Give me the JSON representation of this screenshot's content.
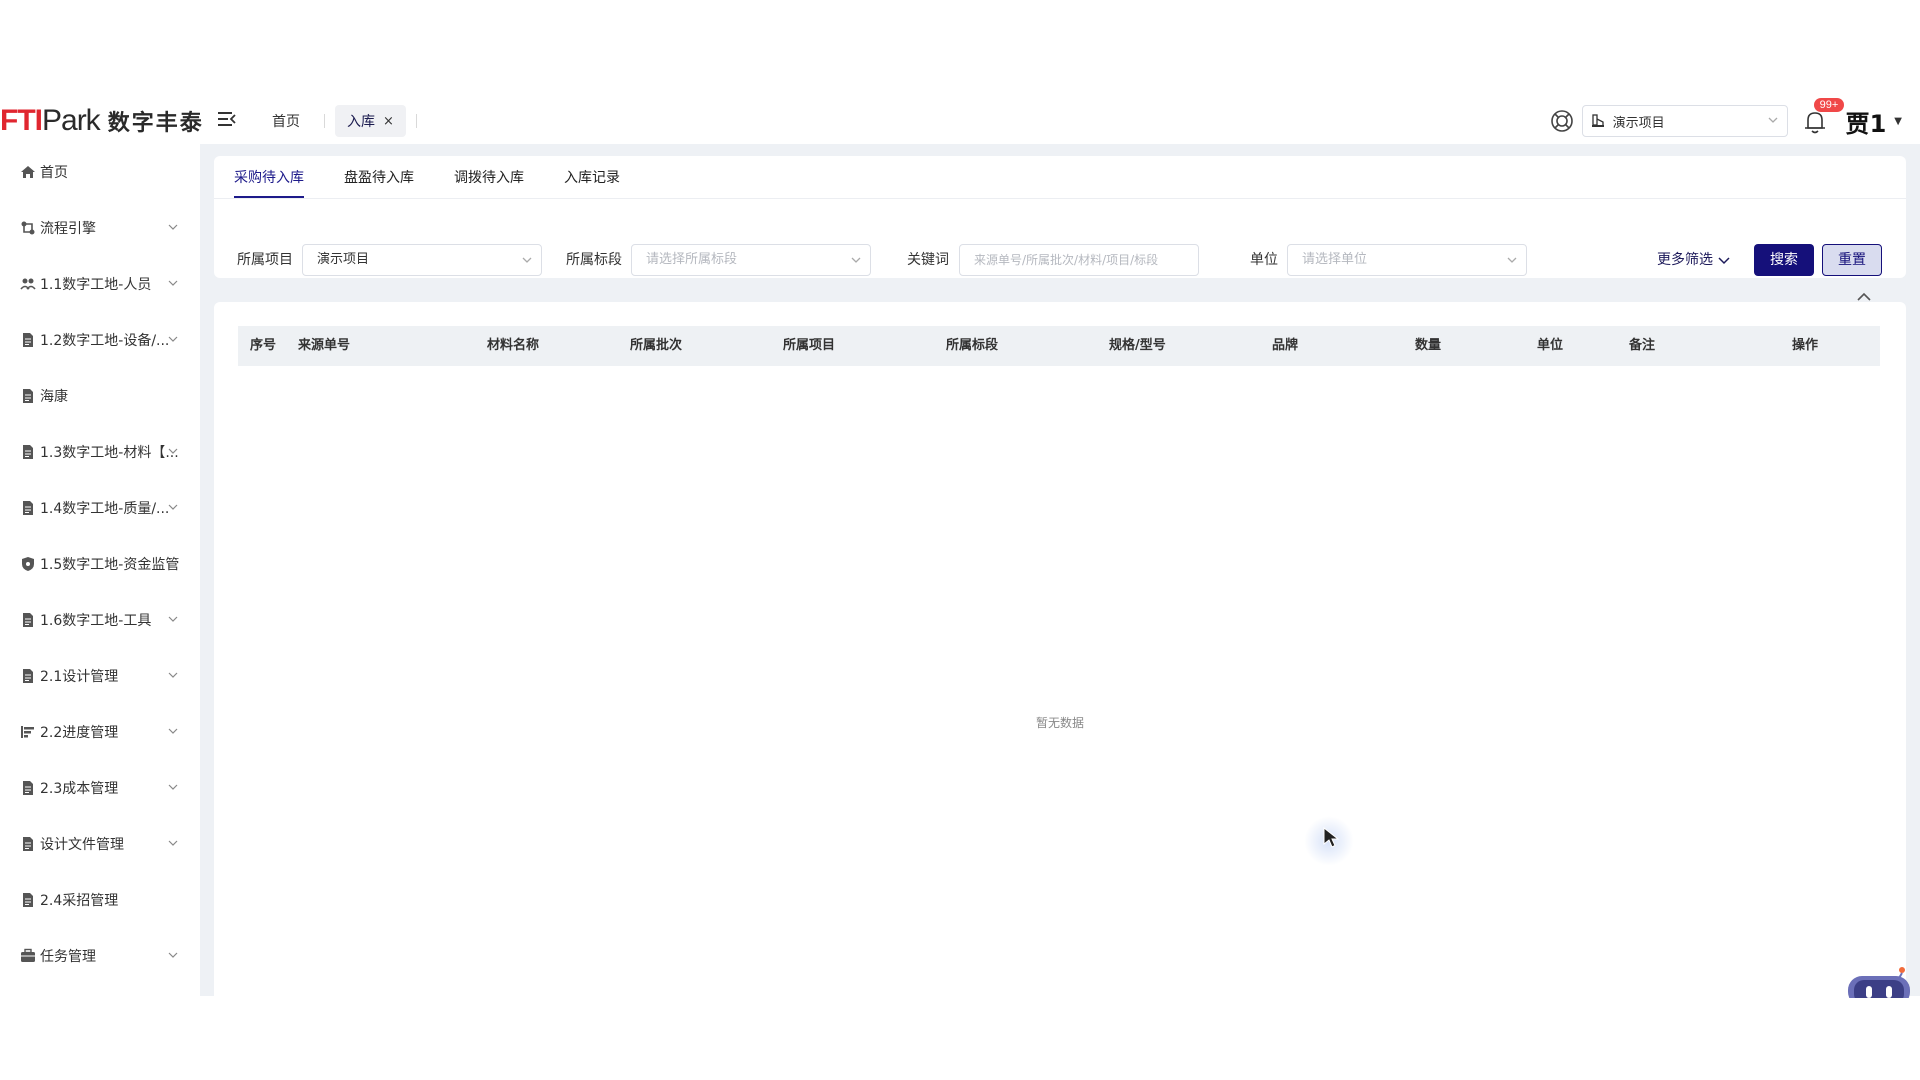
{
  "header": {
    "logo": {
      "part1": "FTI",
      "part2": "Park",
      "cn": "数字丰泰"
    },
    "tabs": {
      "home": "首页",
      "active": "入库",
      "close": "×"
    },
    "project_select": "演示项目",
    "notifications_badge": "99+",
    "user": "贾1"
  },
  "sidebar": {
    "items": [
      {
        "label": "首页",
        "icon": "home-icon",
        "expandable": false
      },
      {
        "label": "流程引擎",
        "icon": "flow-icon",
        "expandable": true
      },
      {
        "label": "1.1数字工地-人员",
        "icon": "people-icon",
        "expandable": true
      },
      {
        "label": "1.2数字工地-设备/...",
        "icon": "document-icon",
        "expandable": true
      },
      {
        "label": "海康",
        "icon": "document-icon",
        "expandable": false
      },
      {
        "label": "1.3数字工地-材料【...",
        "icon": "document-icon",
        "expandable": true
      },
      {
        "label": "1.4数字工地-质量/...",
        "icon": "document-icon",
        "expandable": true
      },
      {
        "label": "1.5数字工地-资金监管",
        "icon": "shield-icon",
        "expandable": false
      },
      {
        "label": "1.6数字工地-工具",
        "icon": "document-icon",
        "expandable": true
      },
      {
        "label": "2.1设计管理",
        "icon": "document-icon",
        "expandable": true
      },
      {
        "label": "2.2进度管理",
        "icon": "gantt-icon",
        "expandable": true
      },
      {
        "label": "2.3成本管理",
        "icon": "document-icon",
        "expandable": true
      },
      {
        "label": "设计文件管理",
        "icon": "document-icon",
        "expandable": true
      },
      {
        "label": "2.4采招管理",
        "icon": "document-icon",
        "expandable": false
      },
      {
        "label": "任务管理",
        "icon": "briefcase-icon",
        "expandable": true
      }
    ]
  },
  "subtabs": [
    "采购待入库",
    "盘盈待入库",
    "调拨待入库",
    "入库记录"
  ],
  "filters": {
    "project_label": "所属项目",
    "project_value": "演示项目",
    "section_label": "所属标段",
    "section_placeholder": "请选择所属标段",
    "keyword_label": "关键词",
    "keyword_placeholder": "来源单号/所属批次/材料/项目/标段",
    "unit_label": "单位",
    "unit_placeholder": "请选择单位",
    "more": "更多筛选",
    "search": "搜索",
    "reset": "重置"
  },
  "table": {
    "columns": [
      "序号",
      "来源单号",
      "材料名称",
      "所属批次",
      "所属项目",
      "所属标段",
      "规格/型号",
      "品牌",
      "数量",
      "单位",
      "备注",
      "操作"
    ],
    "empty": "暂无数据"
  },
  "colors": {
    "primary": "#15107a",
    "badge": "#f04848",
    "logo_red": "#e0262f"
  }
}
